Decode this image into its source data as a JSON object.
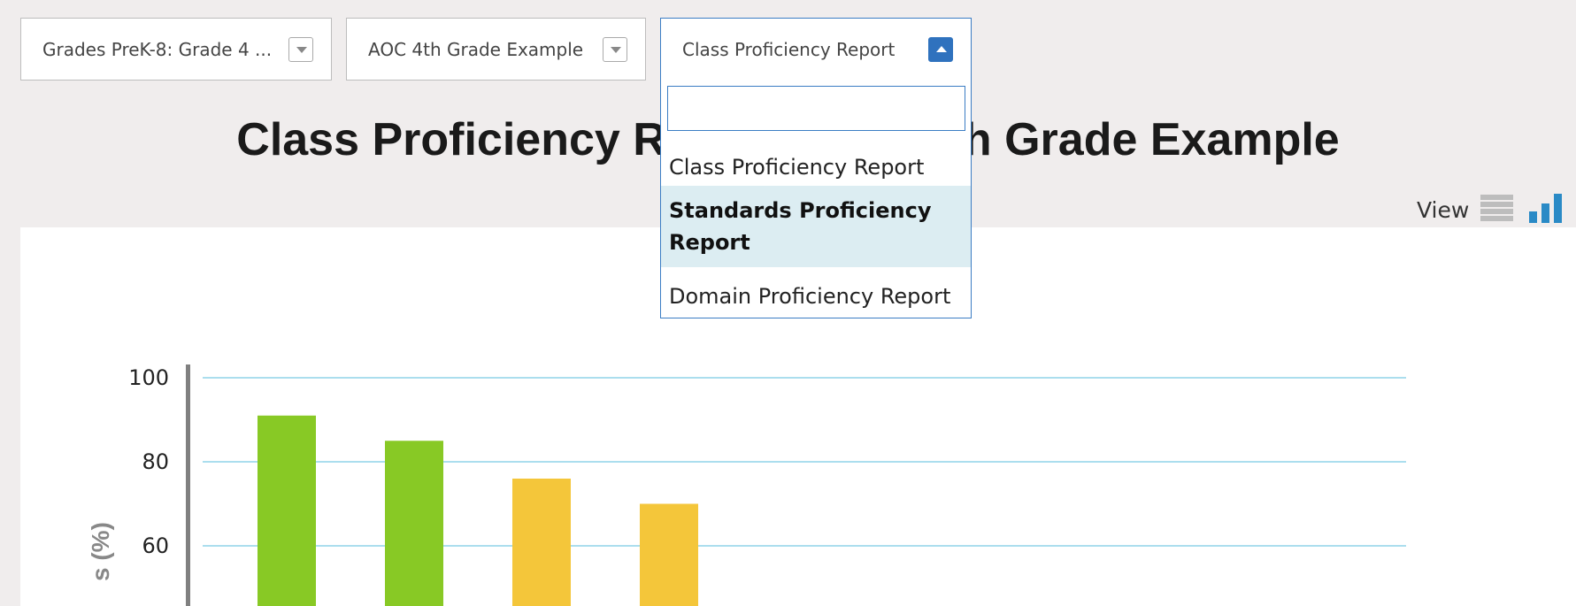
{
  "filters": {
    "grade": {
      "value": "Grades PreK-8: Grade 4 ..."
    },
    "class": {
      "value": "AOC 4th Grade Example"
    },
    "report": {
      "value": "Class Proficiency Report",
      "search_placeholder": "",
      "options": [
        {
          "label": "Class Proficiency Report"
        },
        {
          "label": "Standards Proficiency Report",
          "highlighted": true
        },
        {
          "label": "Domain Proficiency Report"
        }
      ]
    }
  },
  "page": {
    "title": "Class Proficiency Report: AOC 4th Grade Example"
  },
  "view": {
    "label": "View",
    "list_icon": "list-view-icon",
    "chart_icon": "bar-chart-icon",
    "active": "chart"
  },
  "chart_data": {
    "type": "bar",
    "ylabel": "s (%)",
    "ylim": [
      0,
      100
    ],
    "yticks": [
      100,
      80,
      60
    ],
    "values": [
      91,
      85,
      76,
      70
    ],
    "colors": [
      "#88c925",
      "#88c925",
      "#f4c63a",
      "#f4c63a"
    ],
    "gridline_color": "#8fd3e8",
    "axis_color": "#808080"
  }
}
